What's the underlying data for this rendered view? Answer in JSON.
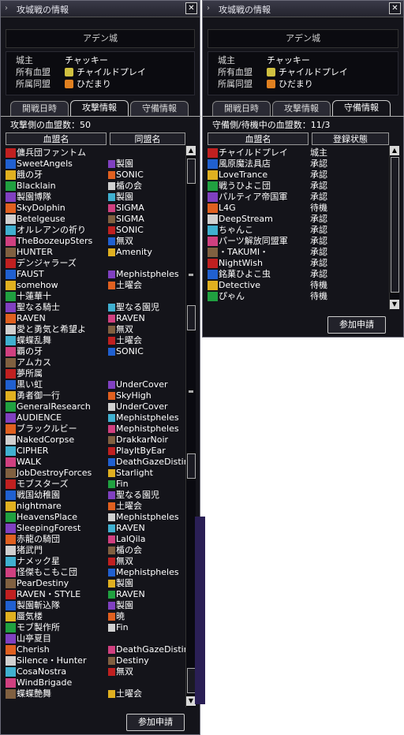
{
  "left": {
    "title": "攻城戦の情報",
    "castle": "アデン城",
    "info": {
      "lord_label": "城主",
      "lord_value": "チャッキー",
      "alliance_label": "所有血盟",
      "alliance_value": "チャイルドプレイ",
      "union_label": "所属同盟",
      "union_value": "ひだまり"
    },
    "tabs": [
      "開戦日時",
      "攻撃情報",
      "守備情報"
    ],
    "active_tab": 1,
    "count_text": "攻撃側の血盟数：50",
    "headers": [
      "血盟名",
      "同盟名"
    ],
    "button": "参加申請",
    "rows": [
      [
        "傭兵団ファントム",
        ""
      ],
      [
        "SweetAngels",
        "製園"
      ],
      [
        "餓の牙",
        "SONIC"
      ],
      [
        "Blacklain",
        "楯の会"
      ],
      [
        "製園博隊",
        "製園"
      ],
      [
        "SkyDolphin",
        "SIGMA"
      ],
      [
        "Betelgeuse",
        "SIGMA"
      ],
      [
        "オルレアンの祈り",
        "SONIC"
      ],
      [
        "TheBoozeupSters",
        "無双"
      ],
      [
        "HUNTER",
        "Amenity"
      ],
      [
        "デンジャラーズ",
        ""
      ],
      [
        "FAUST",
        "Mephistpheles"
      ],
      [
        "somehow",
        "土曜会"
      ],
      [
        "十蓮華十",
        ""
      ],
      [
        "聖なる騎士",
        "聖なる園児"
      ],
      [
        "RAVEN",
        "RAVEN"
      ],
      [
        "愛と勇気と希望よ",
        "無双"
      ],
      [
        "蝶蝶乱舞",
        "土曜会"
      ],
      [
        "覇の牙",
        "SONIC"
      ],
      [
        "アムカス",
        ""
      ],
      [
        "夢所属",
        ""
      ],
      [
        "黒い虹",
        "UnderCover"
      ],
      [
        "勇者御一行",
        "SkyHigh"
      ],
      [
        "GeneralResearch",
        "UnderCover"
      ],
      [
        "AUDIENCE",
        "Mephistpheles"
      ],
      [
        "ブラックルビー",
        "Mephistpheles"
      ],
      [
        "NakedCorpse",
        "DrakkarNoir"
      ],
      [
        "CIPHER",
        "PlayItByEar"
      ],
      [
        "WALK",
        "DeathGazeDistiny"
      ],
      [
        "JobDestroyForces",
        "Starlight"
      ],
      [
        "モブスターズ",
        "Fin"
      ],
      [
        "戦国幼稚園",
        "聖なる園児"
      ],
      [
        "nightmare",
        "土曜会"
      ],
      [
        "HeavensPlace",
        "Mephistpheles"
      ],
      [
        "SleepingForest",
        "RAVEN"
      ],
      [
        "赤龍の騎団",
        "LalQila"
      ],
      [
        "猪武門",
        "楯の会"
      ],
      [
        "ナメック星",
        "無双"
      ],
      [
        "怪傑もこもこ団",
        "Mephistpheles"
      ],
      [
        "PearDestiny",
        "製園"
      ],
      [
        "RAVEN・STYLE",
        "RAVEN"
      ],
      [
        "製園斬込隊",
        "製園"
      ],
      [
        "蜃気楼",
        "暁"
      ],
      [
        "モブ製作所",
        "Fin"
      ],
      [
        "山亭夏目",
        ""
      ],
      [
        "Cherish",
        "DeathGazeDistiny"
      ],
      [
        "Silence・Hunter",
        "Destiny"
      ],
      [
        "CosaNostra",
        "無双"
      ],
      [
        "WindBrigade",
        ""
      ],
      [
        "蝶蝶艶舞",
        "土曜会"
      ]
    ]
  },
  "right": {
    "title": "攻城戦の情報",
    "castle": "アデン城",
    "info": {
      "lord_label": "城主",
      "lord_value": "チャッキー",
      "alliance_label": "所有血盟",
      "alliance_value": "チャイルドプレイ",
      "union_label": "所属同盟",
      "union_value": "ひだまり"
    },
    "tabs": [
      "開戦日時",
      "攻撃情報",
      "守備情報"
    ],
    "active_tab": 2,
    "count_text": "守備側/待機中の血盟数：11/3",
    "headers": [
      "血盟名",
      "登録状態"
    ],
    "button": "参加申請",
    "rows": [
      [
        "チャイルドプレイ",
        "城主"
      ],
      [
        "風原魔法具店",
        "承認"
      ],
      [
        "LoveTrance",
        "承認"
      ],
      [
        "戦うひよこ団",
        "承認"
      ],
      [
        "パルティア帝国軍",
        "承認"
      ],
      [
        "L4G",
        "待機"
      ],
      [
        "DeepStream",
        "承認"
      ],
      [
        "ちゃんこ",
        "承認"
      ],
      [
        "パーツ解放同盟軍",
        "承認"
      ],
      [
        "・TAKUMI・",
        "承認"
      ],
      [
        "NightWish",
        "承認"
      ],
      [
        "銘菓ひよこ虫",
        "承認"
      ],
      [
        "Detective",
        "待機"
      ],
      [
        "ぴゃん",
        "待機"
      ]
    ]
  },
  "colors": {
    "panel_bg": "#14141a",
    "crest_palette": [
      "#c02020",
      "#2060d0",
      "#e0b020",
      "#20a040",
      "#8040c0",
      "#e06020",
      "#d0d0d0",
      "#40b0d0",
      "#d04080",
      "#806040"
    ]
  },
  "icons": {
    "title_icon": "scroll-icon",
    "close": "close-icon",
    "scroll_up": "arrow-up-icon",
    "scroll_down": "arrow-down-icon"
  }
}
